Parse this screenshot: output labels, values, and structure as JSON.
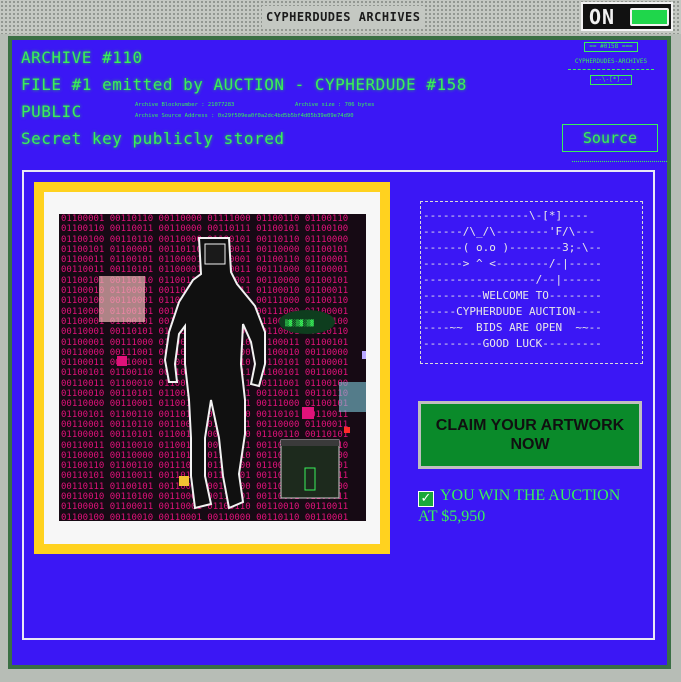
{
  "window": {
    "title": "CYPHERDUDES ARCHIVES",
    "power_label": "ON"
  },
  "header": {
    "archive": "ARCHIVE #110",
    "file": "FILE #1 emitted by AUCTION - CYPHERDUDE #158",
    "visibility": "PUBLIC",
    "secret": "Secret key publicly stored",
    "block_label": "Archive Blocknumber : 21077283",
    "size_label": "Archive size : 706 bytes",
    "address_label": "Archive Source Address : 0x29f509ea0f0a2dc4bd5b5bf4d05b39e09e74d90"
  },
  "mini_logo": {
    "badge": "#0158",
    "caption": "CYPHERDUDES-ARCHIVES"
  },
  "source_button": "Source",
  "artwork": {
    "binary_rows": [
      "01100001 00110110 00110000 01111000 01100110 01100110",
      "01100110 00110011 00110000 00110111 01100101 01100100",
      "01100100 00110110 00110000 01100101 00110110 01110000",
      "01100101 01100001 00110110 00110011 00110000 01100101",
      "01100011 01100101 01100001 00110001 01100110 01100001",
      "00110011 00110101 01100001 00110011 00111000 01100001",
      "01100101 00110110 01100110 01100001 00110000 01100101",
      "01100010 01100001 00110110 00110011 01100010 01100011",
      "01100100 00110001 01100001 01100011 00111000 01100110",
      "00110000 01100101 00110111 00110101 00111000 01100001",
      "01100001 01100101 00110001 00110111 01100101 01100100",
      "00110001 00110101 01100110 00110000 00110001 00110110",
      "01100001 00111000 01100001 00110010 01100011 01100101",
      "00110000 00111001 00110101 01100100 01100010 00110000",
      "01100011 00110001 01100011 00110010 00110101 01100001",
      "01100101 01100110 00110011 01100011 01100101 00110001",
      "00110011 01100010 01100101 00110111 00111001 01100100",
      "01100010 00110101 01100110 01100001 00110011 00110110",
      "00110000 00110001 01100100 00110001 00111000 01100101",
      "01100101 01100110 00110101 01100010 00110101 00110011",
      "00110001 00110110 00110011 01100101 00110000 01100011",
      "01100001 00110101 01100100 00110110 01100110 00110101",
      "00110011 00110010 01100110 00110111 00110001 01100010",
      "01100001 00110000 00110110 01100110 00110101 00111000",
      "01100110 01100110 00111000 01100100 01100001 00110101",
      "00110101 00110011 00110100 01100001 00110010 01100111",
      "00110111 01100101 00110011 00111000 00110110 00110000",
      "00110010 00110100 00110000 00110101 00110001 01100011",
      "01100001 01100011 00110001 01100110 00110010 00110011",
      "01100100 00110010 00110001 00110000 00110110 00110001"
    ]
  },
  "ascii_art": "----------------\\-[*]----\n------/\\_/\\--------'F/\\---\n------( o.o )--------3;-\\--\n------> ^ <--------/-|-----\n-----------------/--|------\n---------WELCOME TO--------\n-----CYPHERDUDE AUCTION----\n----~~  BIDS ARE OPEN  ~~--\n---------GOOD LUCK---------",
  "claim_button": "CLAIM YOUR ARTWORK NOW",
  "win_message": "YOU WIN THE AUCTION AT $5,950",
  "colors": {
    "screen": "#3b17f5",
    "terminal_green": "#39f05a",
    "frame_yellow": "#ffd21f",
    "binary_pink": "#e0127a"
  }
}
